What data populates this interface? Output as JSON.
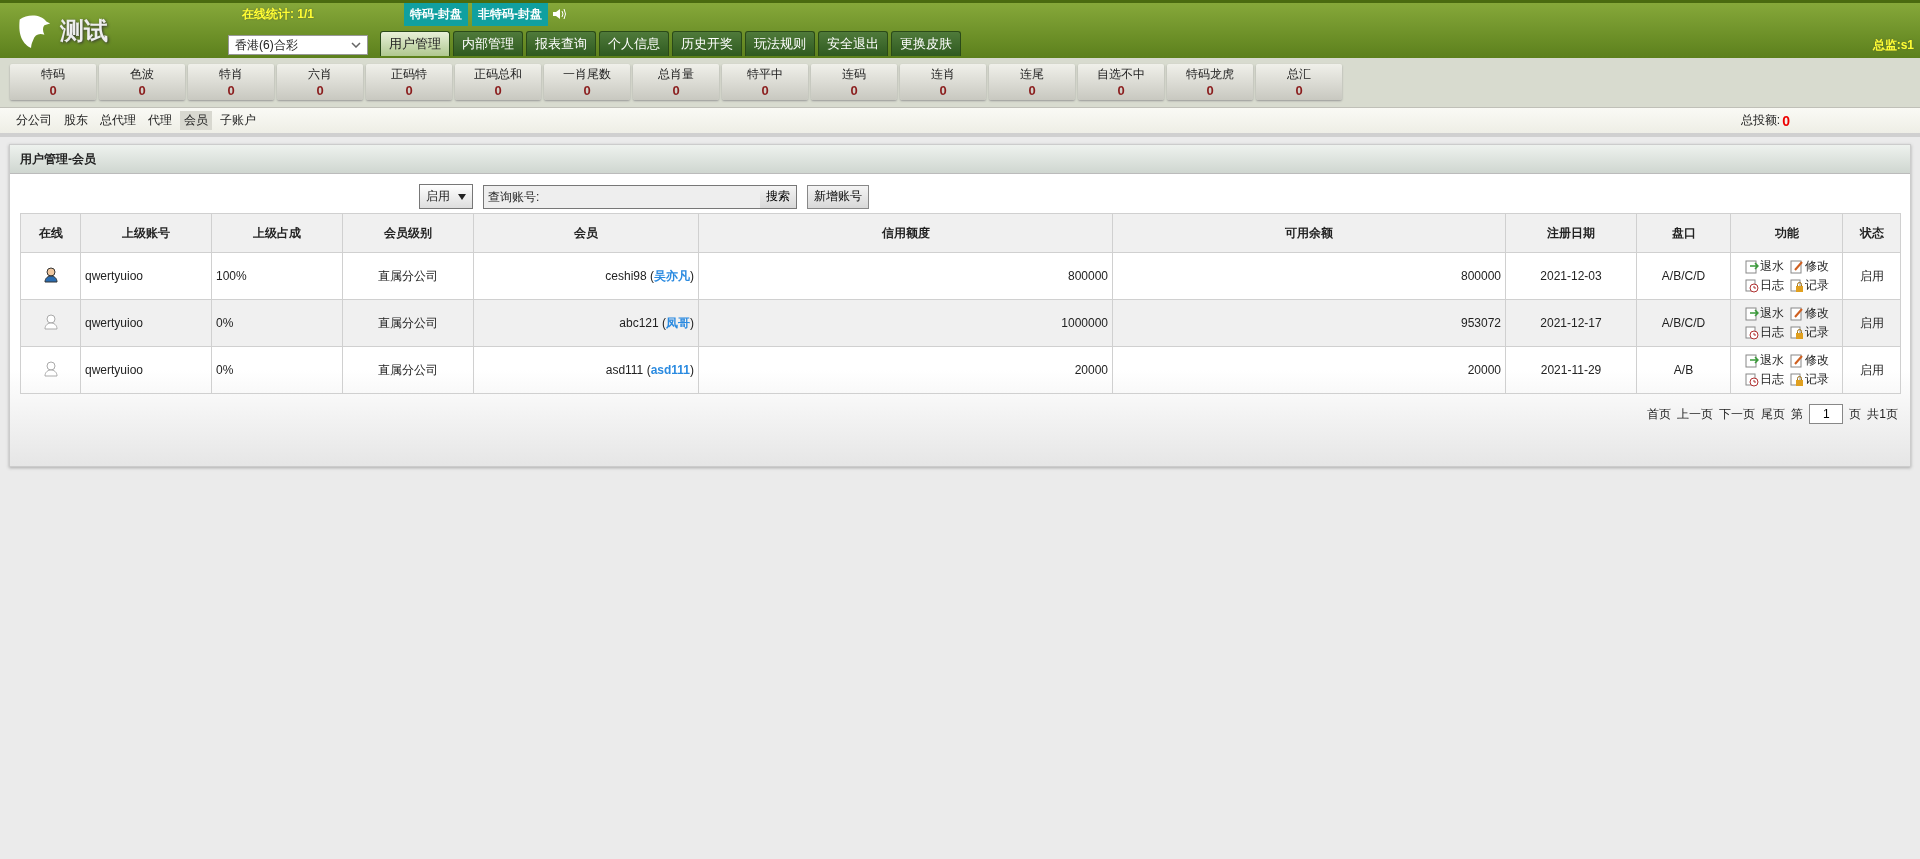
{
  "header": {
    "logo_text": "测试",
    "online_stats": "在线统计: 1/1",
    "status_tags": [
      "特码-封盘",
      "非特码-封盘"
    ],
    "lottery_select": {
      "value": "香港(6)合彩"
    },
    "user": "总监:s1"
  },
  "tabs": [
    {
      "label": "用户管理",
      "selected": true
    },
    {
      "label": "内部管理",
      "selected": false
    },
    {
      "label": "报表查询",
      "selected": false
    },
    {
      "label": "个人信息",
      "selected": false
    },
    {
      "label": "历史开奖",
      "selected": false
    },
    {
      "label": "玩法规则",
      "selected": false
    },
    {
      "label": "安全退出",
      "selected": false
    },
    {
      "label": "更换皮肤",
      "selected": false
    }
  ],
  "stats": [
    {
      "label": "特码",
      "value": "0"
    },
    {
      "label": "色波",
      "value": "0"
    },
    {
      "label": "特肖",
      "value": "0"
    },
    {
      "label": "六肖",
      "value": "0"
    },
    {
      "label": "正码特",
      "value": "0"
    },
    {
      "label": "正码总和",
      "value": "0"
    },
    {
      "label": "一肖尾数",
      "value": "0"
    },
    {
      "label": "总肖量",
      "value": "0"
    },
    {
      "label": "特平中",
      "value": "0"
    },
    {
      "label": "连码",
      "value": "0"
    },
    {
      "label": "连肖",
      "value": "0"
    },
    {
      "label": "连尾",
      "value": "0"
    },
    {
      "label": "自选不中",
      "value": "0"
    },
    {
      "label": "特码龙虎",
      "value": "0"
    },
    {
      "label": "总汇",
      "value": "0"
    }
  ],
  "subnav": {
    "items": [
      {
        "label": "分公司",
        "selected": false
      },
      {
        "label": "股东",
        "selected": false
      },
      {
        "label": "总代理",
        "selected": false
      },
      {
        "label": "代理",
        "selected": false
      },
      {
        "label": "会员",
        "selected": true
      },
      {
        "label": "子账户",
        "selected": false
      }
    ],
    "total_label": "总投额:",
    "total_value": "0"
  },
  "panel": {
    "title": "用户管理-会员",
    "status_filter": "启用",
    "search_label": "查询账号:",
    "search_button": "搜索",
    "add_button": "新增账号"
  },
  "table": {
    "columns": [
      "在线",
      "上级账号",
      "上级占成",
      "会员级别",
      "会员",
      "信用额度",
      "可用余额",
      "注册日期",
      "盘口",
      "功能",
      "状态"
    ],
    "rows": [
      {
        "online": true,
        "parent": "qwertyuioo",
        "share": "100%",
        "level": "直属分公司",
        "member": "ceshi98 (**吴亦凡**)",
        "credit": "800000",
        "balance": "800000",
        "date": "2021-12-03",
        "plate": "A/B/C/D",
        "actions": [
          {
            "kind": "rebate",
            "label": "退水"
          },
          {
            "kind": "edit",
            "label": "修改"
          },
          {
            "kind": "log",
            "label": "日志"
          },
          {
            "kind": "record",
            "label": "记录"
          }
        ],
        "status": "启用"
      },
      {
        "online": false,
        "parent": "qwertyuioo",
        "share": "0%",
        "level": "直属分公司",
        "member": "abc121 (**凤哥**)",
        "credit": "1000000",
        "balance": "953072",
        "date": "2021-12-17",
        "plate": "A/B/C/D",
        "actions": [
          {
            "kind": "rebate",
            "label": "退水"
          },
          {
            "kind": "edit",
            "label": "修改"
          },
          {
            "kind": "log",
            "label": "日志"
          },
          {
            "kind": "record",
            "label": "记录"
          }
        ],
        "status": "启用"
      },
      {
        "online": false,
        "parent": "qwertyuioo",
        "share": "0%",
        "level": "直属分公司",
        "member": "asd111 (**asd111**)",
        "credit": "20000",
        "balance": "20000",
        "date": "2021-11-29",
        "plate": "A/B",
        "actions": [
          {
            "kind": "rebate",
            "label": "退水"
          },
          {
            "kind": "edit",
            "label": "修改"
          },
          {
            "kind": "log",
            "label": "日志"
          },
          {
            "kind": "record",
            "label": "记录"
          }
        ],
        "status": "启用"
      }
    ]
  },
  "pagination": {
    "links": [
      "首页",
      "上一页",
      "下一页",
      "尾页"
    ],
    "page_prefix": "第",
    "page": "1",
    "page_suffix": "页",
    "total": "共1页"
  }
}
